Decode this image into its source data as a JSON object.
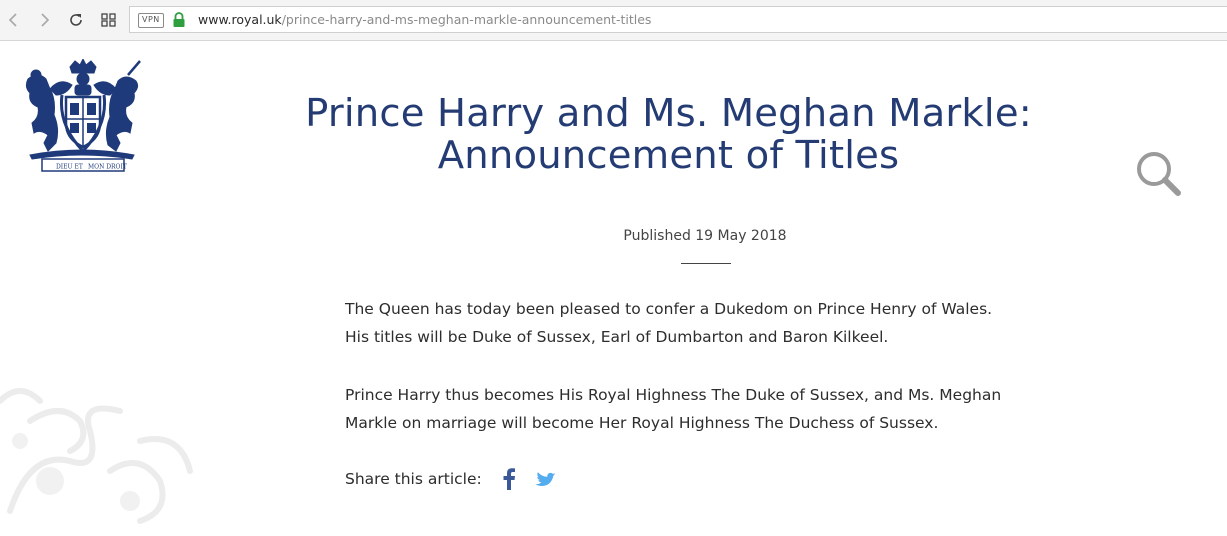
{
  "browser": {
    "vpn_label": "VPN",
    "url_host": "www.royal.uk",
    "url_path": "/prince-harry-and-ms-meghan-markle-announcement-titles",
    "icons": [
      "back-icon",
      "forward-icon",
      "reload-icon",
      "tabs-grid-icon",
      "lock-icon"
    ]
  },
  "header": {
    "title_line1": "Prince Harry and Ms. Meghan Markle:",
    "title_line2": "Announcement of Titles",
    "crest_motto_left": "DIEU ET",
    "crest_motto_right": "MON DROIT",
    "search_icon": "search-icon"
  },
  "article": {
    "published": "Published 19 May 2018",
    "paragraph1_line1": "The Queen has today been pleased to confer a Dukedom on Prince Henry of Wales.",
    "paragraph1_line2": "His titles will be Duke of Sussex, Earl of Dumbarton and Baron Kilkeel.",
    "paragraph2_line1": "Prince Harry thus becomes His Royal Highness The Duke of Sussex, and Ms. Meghan",
    "paragraph2_line2": "Markle on marriage will become Her Royal Highness The Duchess of Sussex."
  },
  "share": {
    "label": "Share this article:",
    "icons": [
      "facebook-icon",
      "twitter-icon"
    ]
  },
  "colors": {
    "title": "#243c73",
    "crest": "#1f3a7a",
    "lock": "#2e9e3e",
    "facebook": "#3b5998",
    "twitter": "#55acee",
    "search": "#9a9a9a"
  }
}
